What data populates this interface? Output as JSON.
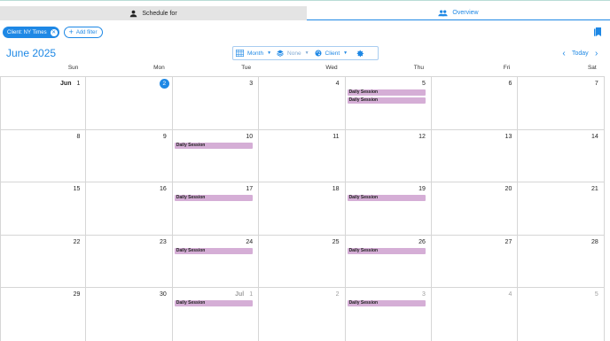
{
  "tabs": {
    "schedule_label": "Schedule for",
    "overview_label": "Overview"
  },
  "filters": {
    "client_chip": "Client: NY Times",
    "add_filter": "Add filter"
  },
  "calendar": {
    "title": "June 2025",
    "toolbar": {
      "view": "Month",
      "layer": "None",
      "color_by": "Client"
    },
    "nav": {
      "today": "Today"
    },
    "weekdays": [
      "Sun",
      "Mon",
      "Tue",
      "Wed",
      "Thu",
      "Fri",
      "Sat"
    ],
    "weeks": [
      [
        {
          "num": "1",
          "month_label": "Jun",
          "events": []
        },
        {
          "num": "2",
          "is_today": true,
          "events": []
        },
        {
          "num": "3",
          "events": []
        },
        {
          "num": "4",
          "events": []
        },
        {
          "num": "5",
          "events": [
            "Daily Session",
            "Daily Session"
          ]
        },
        {
          "num": "6",
          "events": []
        },
        {
          "num": "7",
          "events": []
        }
      ],
      [
        {
          "num": "8",
          "events": []
        },
        {
          "num": "9",
          "events": []
        },
        {
          "num": "10",
          "events": [
            "Daily Session"
          ]
        },
        {
          "num": "11",
          "events": []
        },
        {
          "num": "12",
          "events": []
        },
        {
          "num": "13",
          "events": []
        },
        {
          "num": "14",
          "events": []
        }
      ],
      [
        {
          "num": "15",
          "events": []
        },
        {
          "num": "16",
          "events": []
        },
        {
          "num": "17",
          "events": [
            "Daily Session"
          ]
        },
        {
          "num": "18",
          "events": []
        },
        {
          "num": "19",
          "events": [
            "Daily Session"
          ]
        },
        {
          "num": "20",
          "events": []
        },
        {
          "num": "21",
          "events": []
        }
      ],
      [
        {
          "num": "22",
          "events": []
        },
        {
          "num": "23",
          "events": []
        },
        {
          "num": "24",
          "events": [
            "Daily Session"
          ]
        },
        {
          "num": "25",
          "events": []
        },
        {
          "num": "26",
          "events": [
            "Daily Session"
          ]
        },
        {
          "num": "27",
          "events": []
        },
        {
          "num": "28",
          "events": []
        }
      ],
      [
        {
          "num": "29",
          "events": []
        },
        {
          "num": "30",
          "events": []
        },
        {
          "num": "1",
          "month_label": "Jul",
          "other_month": true,
          "events": [
            "Daily Session"
          ]
        },
        {
          "num": "2",
          "other_month": true,
          "events": []
        },
        {
          "num": "3",
          "other_month": true,
          "events": [
            "Daily Session"
          ]
        },
        {
          "num": "4",
          "other_month": true,
          "events": []
        },
        {
          "num": "5",
          "other_month": true,
          "events": []
        }
      ]
    ]
  },
  "colors": {
    "accent": "#1e88e5",
    "event_bg": "#d5aed6",
    "tab_inactive_bg": "#e4e4e4"
  },
  "icons": {
    "schedule_tab": "person-icon",
    "overview_tab": "group-icon",
    "view": "grid-icon",
    "layer": "layers-icon",
    "color_by": "palette-icon",
    "settings": "gear-icon",
    "bookmarks": "bookmarks-icon"
  }
}
